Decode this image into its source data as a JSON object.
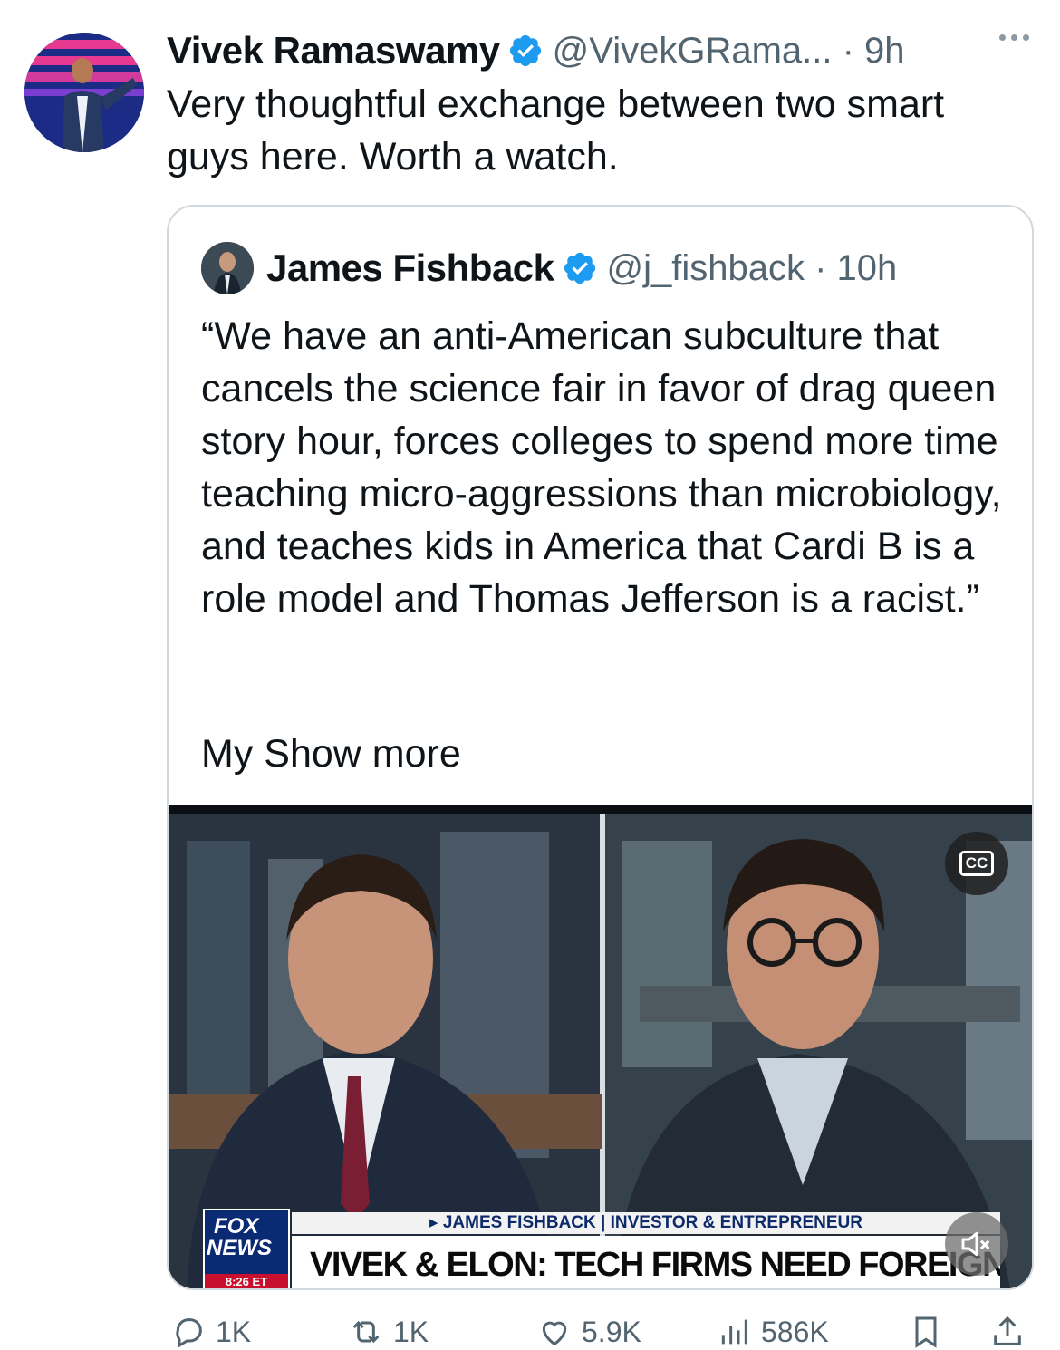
{
  "tweet": {
    "author_name": "Vivek Ramaswamy",
    "handle_time": "@VivekGRama... · 9h",
    "text": "Very thoughtful exchange between two smart guys here. Worth a watch."
  },
  "quoted": {
    "author_name": "James Fishback",
    "handle_time": "@j_fishback · 10h",
    "text": "“We have an anti-American subculture that cancels the science fair in favor of drag queen story hour, forces colleges to spend more time teaching micro-aggressions than microbiology, and teaches kids in America that Cardi B is a role model and Thomas Jefferson is a racist.”",
    "show_more_prefix": "My",
    "show_more_label": "Show more",
    "video": {
      "cc_label": "CC",
      "chyron_top": "▸ JAMES FISHBACK | INVESTOR & ENTREPRENEUR",
      "chyron_main": "VIVEK & ELON: TECH FIRMS NEED FOREIGN HIRES",
      "network_line1": "FOX",
      "network_line2": "NEWS",
      "time": "8:26 ET"
    }
  },
  "actions": {
    "replies": "1K",
    "reposts": "1K",
    "likes": "5.9K",
    "views": "586K"
  },
  "colors": {
    "verified": "#1d9bf0",
    "secondary_text": "#536471",
    "border": "#cfd9de"
  },
  "icons": [
    "verified-badge-icon",
    "more-icon",
    "cc-icon",
    "mute-icon",
    "reply-icon",
    "repost-icon",
    "like-icon",
    "views-icon",
    "bookmark-icon",
    "share-icon"
  ]
}
